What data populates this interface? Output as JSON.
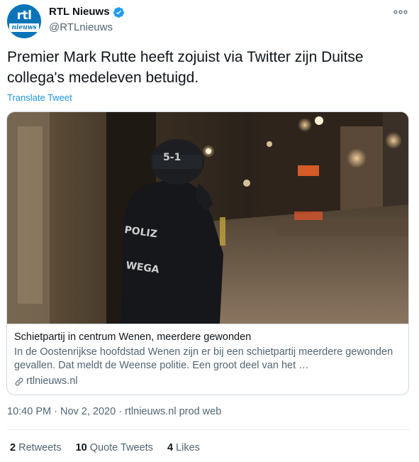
{
  "account": {
    "display_name": "RTL Nieuws",
    "handle": "@RTLnieuws",
    "avatar_text_top": "rtl",
    "avatar_text_bottom": "nieuws",
    "brand_color": "#0a74b8",
    "verified": true
  },
  "tweet": {
    "text": "Premier Mark Rutte heeft zojuist via Twitter zijn Duitse collega's medeleven betuigd.",
    "translate_label": "Translate Tweet"
  },
  "card": {
    "title": "Schietpartij in centrum Wenen, meerdere gewonden",
    "description": "In de Oostenrijkse hoofdstad Wenen zijn er bij een schietpartij meerdere gewonden gevallen. Dat meldt de Weense politie. Een groot deel van het …",
    "domain": "rtlnieuws.nl",
    "image": {
      "helmet_text": "5-1",
      "vest_text_1": "POLIZ",
      "vest_text_2": "WEGA"
    }
  },
  "meta": {
    "time": "10:40 PM",
    "separator": " · ",
    "date": "Nov 2, 2020",
    "source": "rtlnieuws.nl prod web"
  },
  "stats": {
    "retweets_count": "2",
    "retweets_label": "Retweets",
    "quotes_count": "10",
    "quotes_label": "Quote Tweets",
    "likes_count": "4",
    "likes_label": "Likes"
  },
  "colors": {
    "link": "#1b95e0",
    "secondary_text": "#536471",
    "verified": "#1d9bf0"
  }
}
